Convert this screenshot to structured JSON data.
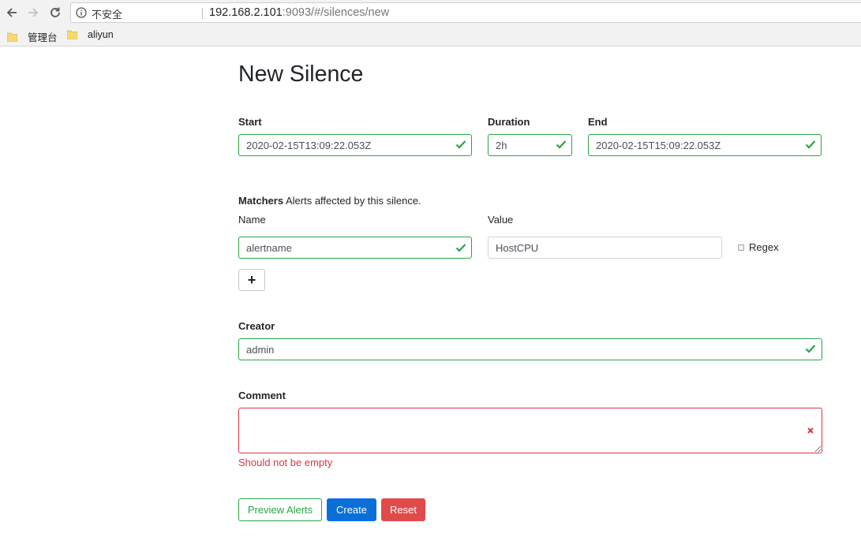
{
  "browser": {
    "security_label": "不安全",
    "url_host": "192.168.2.101",
    "url_path": ":9093/#/silences/new",
    "bookmarks": [
      {
        "label": "管理台"
      },
      {
        "label": "aliyun"
      }
    ]
  },
  "page": {
    "title": "New Silence"
  },
  "form": {
    "start": {
      "label": "Start",
      "value": "2020-02-15T13:09:22.053Z"
    },
    "duration": {
      "label": "Duration",
      "value": "2h"
    },
    "end": {
      "label": "End",
      "value": "2020-02-15T15:09:22.053Z"
    },
    "matchers": {
      "label": "Matchers",
      "description": "Alerts affected by this silence.",
      "name_header": "Name",
      "value_header": "Value",
      "rows": [
        {
          "name": "alertname",
          "value": "HostCPU",
          "regex_label": "Regex",
          "regex_checked": false
        }
      ],
      "add_label": "+"
    },
    "creator": {
      "label": "Creator",
      "value": "admin"
    },
    "comment": {
      "label": "Comment",
      "value": "",
      "error": "Should not be empty"
    }
  },
  "buttons": {
    "preview": "Preview Alerts",
    "create": "Create",
    "reset": "Reset"
  },
  "colors": {
    "valid": "#28a745",
    "invalid": "#dc3545",
    "primary": "#0a6fd6",
    "reset": "#e04a4a"
  }
}
